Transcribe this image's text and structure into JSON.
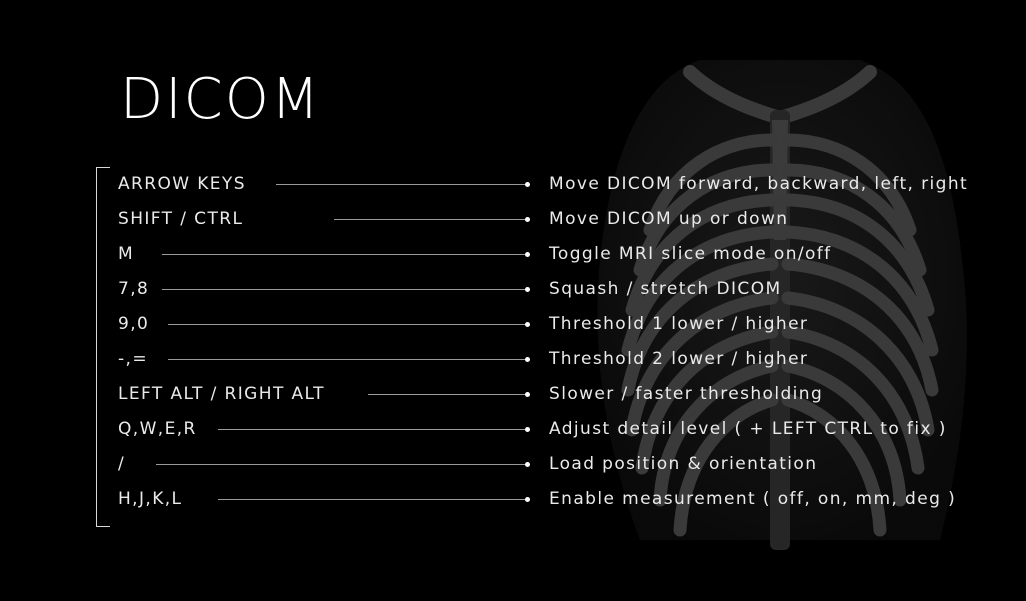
{
  "title": "DICOM",
  "shortcuts": [
    {
      "key": "ARROW KEYS",
      "action": "Move DICOM forward, backward, left, right"
    },
    {
      "key": "SHIFT / CTRL",
      "action": "Move DICOM up or down"
    },
    {
      "key": "M",
      "action": "Toggle MRI slice mode on/off"
    },
    {
      "key": "7,8",
      "action": "Squash / stretch DICOM"
    },
    {
      "key": "9,0",
      "action": "Threshold 1 lower / higher"
    },
    {
      "key": "-,=",
      "action": "Threshold 2 lower / higher"
    },
    {
      "key": "LEFT ALT / RIGHT ALT",
      "action": "Slower / faster thresholding"
    },
    {
      "key": "Q,W,E,R",
      "action": "Adjust detail level ( + LEFT CTRL to fix )"
    },
    {
      "key": "/",
      "action": "Load position & orientation"
    },
    {
      "key": "H,J,K,L",
      "action": "Enable measurement ( off, on, mm, deg )"
    }
  ],
  "colors": {
    "background": "#000000",
    "text": "#eaeaea",
    "ribcage": "#3a3a3a",
    "leader": "#9a9a9a"
  },
  "background_image": "ribcage-xray"
}
